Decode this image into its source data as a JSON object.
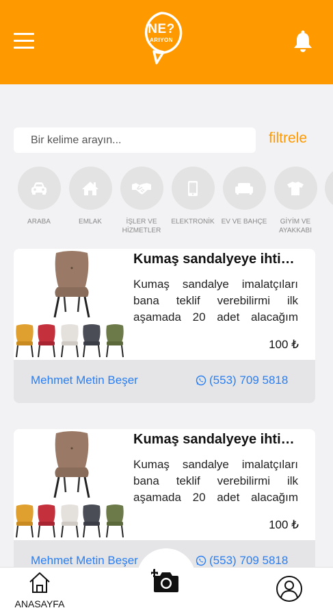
{
  "header": {
    "logo_text_main": "NE?",
    "logo_text_sub": "ARIYON"
  },
  "search": {
    "placeholder": "Bir kelime arayın...",
    "filter_label": "filtrele"
  },
  "categories": [
    {
      "label": "ARABA",
      "icon": "car-icon"
    },
    {
      "label": "EMLAK",
      "icon": "house-icon"
    },
    {
      "label": "İŞLER VE\nHİZMETLER",
      "icon": "handshake-icon"
    },
    {
      "label": "ELEKTRONİK",
      "icon": "phone-icon"
    },
    {
      "label": "EV VE BAHÇE",
      "icon": "sofa-icon"
    },
    {
      "label": "GİYİM VE\nAYAKKABI",
      "icon": "tshirt-icon"
    }
  ],
  "listings": [
    {
      "title": "Kumaş sandalyeye ihtiyacım var",
      "description": "Kumaş sandalye imalatçıları bana teklif verebilirmi ilk aşamada 20 adet alacağım sonraki aşamada daha fazla alırım",
      "price": "100 ₺",
      "seller": "Mehmet Metin Beşer",
      "phone": "(553) 709 5818"
    },
    {
      "title": "Kumaş sandalyeye ihtiyacım var",
      "description": "Kumaş sandalye imalatçıları bana teklif verebilirmi ilk aşamada 20 adet alacağım sonraki aşamada daha fazla alırım",
      "price": "100 ₺",
      "seller": "Mehmet Metin Beşer",
      "phone": "(553) 709 5818"
    }
  ],
  "nav": {
    "home_label": "ANASAYFA"
  },
  "colors": {
    "brand": "#ff9900",
    "link": "#2a7ef0"
  }
}
